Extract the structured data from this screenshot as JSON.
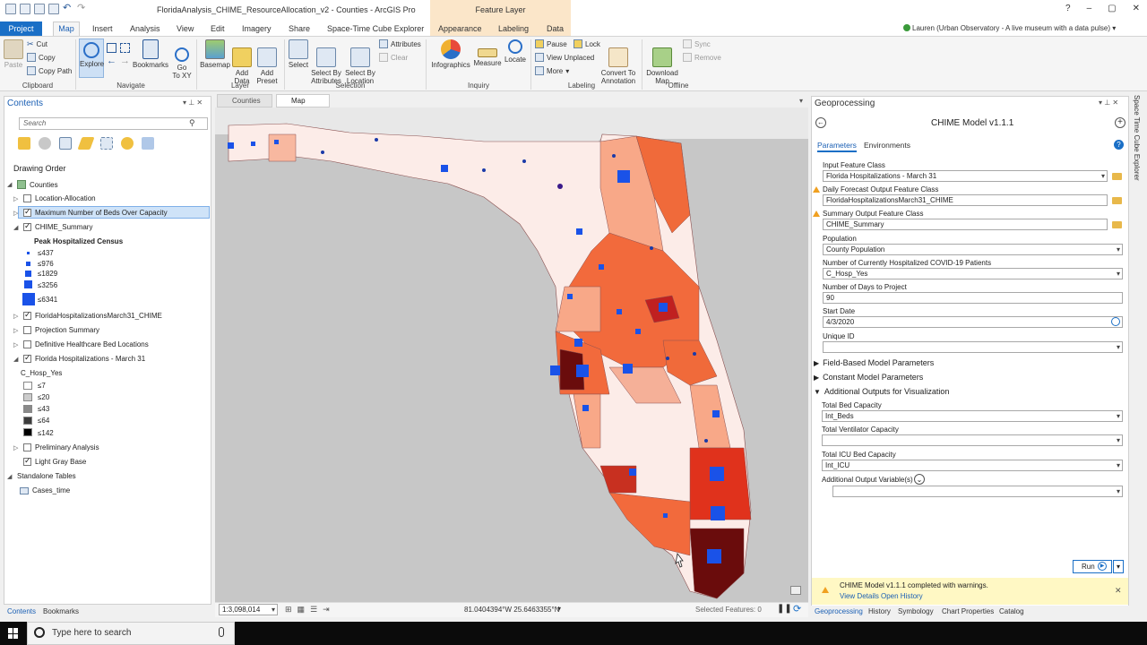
{
  "window": {
    "title": "FloridaAnalysis_CHIME_ResourceAllocation_v2 - Counties - ArcGIS Pro",
    "feature_layer_label": "Feature Layer",
    "help": "?",
    "minimize": "–",
    "restore": "▢",
    "close": "✕"
  },
  "ribbon_tabs": [
    "Project",
    "Map",
    "Insert",
    "Analysis",
    "View",
    "Edit",
    "Imagery",
    "Share",
    "Space-Time Cube Explorer",
    "Appearance",
    "Labeling",
    "Data"
  ],
  "user": {
    "name": "Lauren (Urban Observatory - A live museum with a data pulse)"
  },
  "ribbon": {
    "clipboard": {
      "paste": "Paste",
      "cut": "Cut",
      "copy": "Copy",
      "copy_path": "Copy Path",
      "group": "Clipboard"
    },
    "navigate": {
      "explore": "Explore",
      "bookmarks": "Bookmarks",
      "goto": "Go\nTo XY",
      "group": "Navigate"
    },
    "layer": {
      "basemap": "Basemap",
      "add_data": "Add\nData",
      "add_preset": "Add\nPreset",
      "group": "Layer"
    },
    "selection": {
      "select": "Select",
      "by_attributes": "Select By\nAttributes",
      "by_location": "Select By\nLocation",
      "attributes": "Attributes",
      "clear": "Clear",
      "group": "Selection"
    },
    "inquiry": {
      "infographics": "Infographics",
      "measure": "Measure",
      "locate": "Locate",
      "group": "Inquiry"
    },
    "labeling": {
      "pause": "Pause",
      "lock": "Lock",
      "view_unplaced": "View Unplaced",
      "more": "More",
      "convert": "Convert To\nAnnotation",
      "group": "Labeling"
    },
    "offline": {
      "download": "Download\nMap",
      "sync": "Sync",
      "remove": "Remove",
      "group": "Offline"
    }
  },
  "contents": {
    "title": "Contents",
    "search_placeholder": "Search",
    "drawing_order": "Drawing Order",
    "layers": {
      "counties": "Counties",
      "location_allocation": "Location-Allocation",
      "max_beds": "Maximum Number of Beds Over Capacity",
      "chime_summary": "CHIME_Summary",
      "peak_label": "Peak Hospitalized Census",
      "peak_classes": [
        "≤437",
        "≤976",
        "≤1829",
        "≤3256",
        "≤6341"
      ],
      "fl_hosp_chime": "FloridaHospitalizationsMarch31_CHIME",
      "projection_summary": "Projection Summary",
      "definitive": "Definitive Healthcare Bed Locations",
      "fl_hosp": "Florida Hospitalizations - March 31",
      "c_hosp_label": "C_Hosp_Yes",
      "hosp_classes": [
        "≤7",
        "≤20",
        "≤43",
        "≤64",
        "≤142"
      ],
      "preliminary": "Preliminary Analysis",
      "light_gray": "Light Gray Base",
      "standalone": "Standalone Tables",
      "cases_time": "Cases_time"
    },
    "tabs": [
      "Contents",
      "Bookmarks"
    ]
  },
  "map": {
    "tabs": [
      "Counties",
      "Map"
    ],
    "scale": "1:3,098,014",
    "coordinates": "81.0404394°W 25.6463355°N",
    "selected_features": "Selected Features: 0"
  },
  "geoprocessing": {
    "title": "Geoprocessing",
    "tool": "CHIME Model v1.1.1",
    "tabs": [
      "Parameters",
      "Environments"
    ],
    "fields": [
      {
        "label": "Input Feature Class",
        "value": "Florida Hospitalizations - March 31"
      },
      {
        "label": "Daily Forecast Output Feature Class",
        "value": "FloridaHospitalizationsMarch31_CHIME"
      },
      {
        "label": "Summary Output Feature Class",
        "value": "CHIME_Summary"
      },
      {
        "label": "Population",
        "value": "County Population"
      },
      {
        "label": "Number of Currently Hospitalized COVID-19 Patients",
        "value": "C_Hosp_Yes"
      },
      {
        "label": "Number of Days to Project",
        "value": "90"
      },
      {
        "label": "Start Date",
        "value": "4/3/2020"
      },
      {
        "label": "Unique ID",
        "value": ""
      }
    ],
    "sections": [
      "Field-Based Model Parameters",
      "Constant Model Parameters",
      "Additional Outputs for Visualization"
    ],
    "viz_fields": [
      {
        "label": "Total Bed Capacity",
        "value": "Int_Beds"
      },
      {
        "label": "Total Ventilator Capacity",
        "value": ""
      },
      {
        "label": "Total ICU Bed Capacity",
        "value": "Int_ICU"
      },
      {
        "label": "Additional Output Variable(s)",
        "value": ""
      }
    ],
    "run": "Run",
    "message": "CHIME Model v1.1.1 completed with warnings.",
    "view_details": "View Details",
    "open_history": "Open History",
    "bottom_tabs": [
      "Geoprocessing",
      "History",
      "Symbology",
      "Chart Properties",
      "Catalog"
    ]
  },
  "side_panel": "Space Time Cube Explorer",
  "taskbar": {
    "search_placeholder": "Type here to search"
  },
  "colors": {
    "accent": "#1a6fc6",
    "selection": "#cfe3f8",
    "warning": "#f0a020",
    "symbol": "#1a52e8"
  }
}
